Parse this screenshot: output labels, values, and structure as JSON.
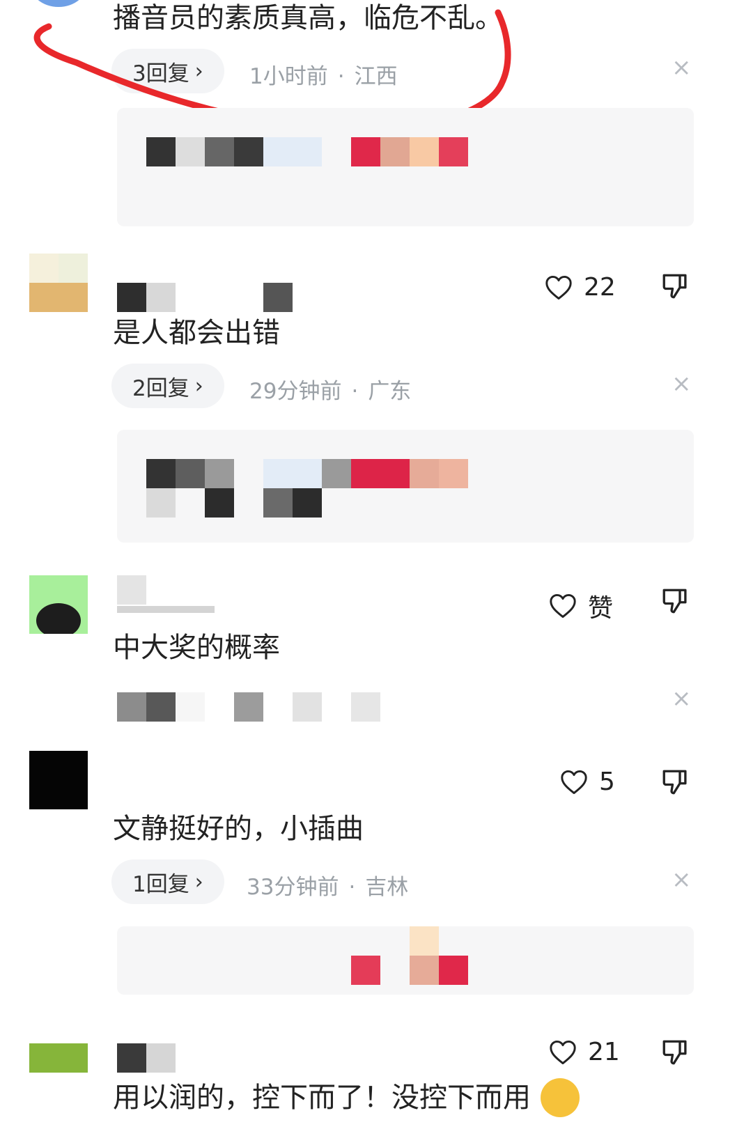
{
  "comments": [
    {
      "text": "播音员的素质真高，临危不乱。",
      "replies": "3回复",
      "time": "1小时前",
      "location": "江西"
    },
    {
      "likes": "22",
      "text": "是人都会出错",
      "replies": "2回复",
      "time": "29分钟前",
      "location": "广东"
    },
    {
      "likes": "赞",
      "text": "中大奖的概率"
    },
    {
      "likes": "5",
      "text": "文静挺好的，小插曲",
      "replies": "1回复",
      "time": "33分钟前",
      "location": "吉林"
    },
    {
      "likes": "21",
      "text": "用以润的，控下而了！没控下而用"
    }
  ],
  "symbols": {
    "chevron": "›",
    "dot": "·",
    "close": "×"
  },
  "colors": {
    "annotation": "#e8282b",
    "reply_pill_bg": "#f3f4f6",
    "meta_text": "#9aa0a6"
  },
  "icons": [
    "heart-outline-icon",
    "thumbs-down-icon",
    "close-icon",
    "chevron-right-icon"
  ]
}
